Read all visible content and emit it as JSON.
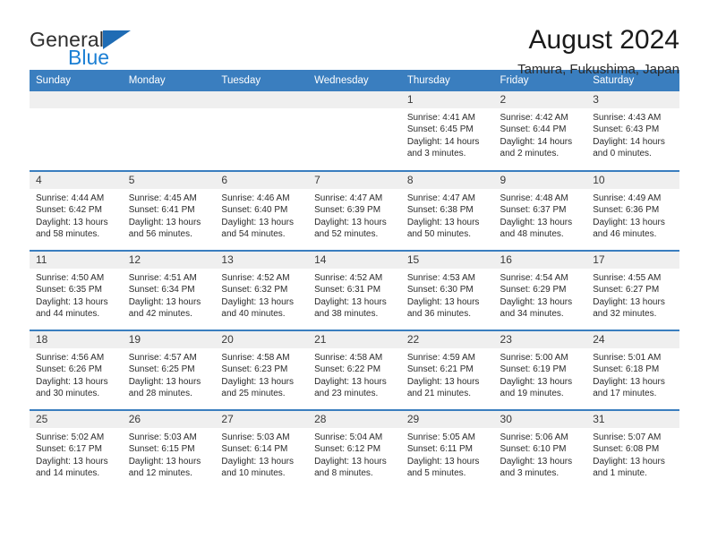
{
  "brand": {
    "name_part1": "General",
    "name_part2": "Blue",
    "logo_icon": "triangle-flag-icon",
    "accent_color": "#1f6cb4"
  },
  "header": {
    "title": "August 2024",
    "subtitle": "Tamura, Fukushima, Japan"
  },
  "calendar": {
    "header_bg": "#3a7ebf",
    "daynum_bg": "#efefef",
    "weekdays": [
      "Sunday",
      "Monday",
      "Tuesday",
      "Wednesday",
      "Thursday",
      "Friday",
      "Saturday"
    ],
    "labels": {
      "sunrise": "Sunrise:",
      "sunset": "Sunset:",
      "daylight": "Daylight:"
    },
    "weeks": [
      [
        {
          "day": ""
        },
        {
          "day": ""
        },
        {
          "day": ""
        },
        {
          "day": ""
        },
        {
          "day": "1",
          "sunrise": "Sunrise: 4:41 AM",
          "sunset": "Sunset: 6:45 PM",
          "daylight1": "Daylight: 14 hours",
          "daylight2": "and 3 minutes."
        },
        {
          "day": "2",
          "sunrise": "Sunrise: 4:42 AM",
          "sunset": "Sunset: 6:44 PM",
          "daylight1": "Daylight: 14 hours",
          "daylight2": "and 2 minutes."
        },
        {
          "day": "3",
          "sunrise": "Sunrise: 4:43 AM",
          "sunset": "Sunset: 6:43 PM",
          "daylight1": "Daylight: 14 hours",
          "daylight2": "and 0 minutes."
        }
      ],
      [
        {
          "day": "4",
          "sunrise": "Sunrise: 4:44 AM",
          "sunset": "Sunset: 6:42 PM",
          "daylight1": "Daylight: 13 hours",
          "daylight2": "and 58 minutes."
        },
        {
          "day": "5",
          "sunrise": "Sunrise: 4:45 AM",
          "sunset": "Sunset: 6:41 PM",
          "daylight1": "Daylight: 13 hours",
          "daylight2": "and 56 minutes."
        },
        {
          "day": "6",
          "sunrise": "Sunrise: 4:46 AM",
          "sunset": "Sunset: 6:40 PM",
          "daylight1": "Daylight: 13 hours",
          "daylight2": "and 54 minutes."
        },
        {
          "day": "7",
          "sunrise": "Sunrise: 4:47 AM",
          "sunset": "Sunset: 6:39 PM",
          "daylight1": "Daylight: 13 hours",
          "daylight2": "and 52 minutes."
        },
        {
          "day": "8",
          "sunrise": "Sunrise: 4:47 AM",
          "sunset": "Sunset: 6:38 PM",
          "daylight1": "Daylight: 13 hours",
          "daylight2": "and 50 minutes."
        },
        {
          "day": "9",
          "sunrise": "Sunrise: 4:48 AM",
          "sunset": "Sunset: 6:37 PM",
          "daylight1": "Daylight: 13 hours",
          "daylight2": "and 48 minutes."
        },
        {
          "day": "10",
          "sunrise": "Sunrise: 4:49 AM",
          "sunset": "Sunset: 6:36 PM",
          "daylight1": "Daylight: 13 hours",
          "daylight2": "and 46 minutes."
        }
      ],
      [
        {
          "day": "11",
          "sunrise": "Sunrise: 4:50 AM",
          "sunset": "Sunset: 6:35 PM",
          "daylight1": "Daylight: 13 hours",
          "daylight2": "and 44 minutes."
        },
        {
          "day": "12",
          "sunrise": "Sunrise: 4:51 AM",
          "sunset": "Sunset: 6:34 PM",
          "daylight1": "Daylight: 13 hours",
          "daylight2": "and 42 minutes."
        },
        {
          "day": "13",
          "sunrise": "Sunrise: 4:52 AM",
          "sunset": "Sunset: 6:32 PM",
          "daylight1": "Daylight: 13 hours",
          "daylight2": "and 40 minutes."
        },
        {
          "day": "14",
          "sunrise": "Sunrise: 4:52 AM",
          "sunset": "Sunset: 6:31 PM",
          "daylight1": "Daylight: 13 hours",
          "daylight2": "and 38 minutes."
        },
        {
          "day": "15",
          "sunrise": "Sunrise: 4:53 AM",
          "sunset": "Sunset: 6:30 PM",
          "daylight1": "Daylight: 13 hours",
          "daylight2": "and 36 minutes."
        },
        {
          "day": "16",
          "sunrise": "Sunrise: 4:54 AM",
          "sunset": "Sunset: 6:29 PM",
          "daylight1": "Daylight: 13 hours",
          "daylight2": "and 34 minutes."
        },
        {
          "day": "17",
          "sunrise": "Sunrise: 4:55 AM",
          "sunset": "Sunset: 6:27 PM",
          "daylight1": "Daylight: 13 hours",
          "daylight2": "and 32 minutes."
        }
      ],
      [
        {
          "day": "18",
          "sunrise": "Sunrise: 4:56 AM",
          "sunset": "Sunset: 6:26 PM",
          "daylight1": "Daylight: 13 hours",
          "daylight2": "and 30 minutes."
        },
        {
          "day": "19",
          "sunrise": "Sunrise: 4:57 AM",
          "sunset": "Sunset: 6:25 PM",
          "daylight1": "Daylight: 13 hours",
          "daylight2": "and 28 minutes."
        },
        {
          "day": "20",
          "sunrise": "Sunrise: 4:58 AM",
          "sunset": "Sunset: 6:23 PM",
          "daylight1": "Daylight: 13 hours",
          "daylight2": "and 25 minutes."
        },
        {
          "day": "21",
          "sunrise": "Sunrise: 4:58 AM",
          "sunset": "Sunset: 6:22 PM",
          "daylight1": "Daylight: 13 hours",
          "daylight2": "and 23 minutes."
        },
        {
          "day": "22",
          "sunrise": "Sunrise: 4:59 AM",
          "sunset": "Sunset: 6:21 PM",
          "daylight1": "Daylight: 13 hours",
          "daylight2": "and 21 minutes."
        },
        {
          "day": "23",
          "sunrise": "Sunrise: 5:00 AM",
          "sunset": "Sunset: 6:19 PM",
          "daylight1": "Daylight: 13 hours",
          "daylight2": "and 19 minutes."
        },
        {
          "day": "24",
          "sunrise": "Sunrise: 5:01 AM",
          "sunset": "Sunset: 6:18 PM",
          "daylight1": "Daylight: 13 hours",
          "daylight2": "and 17 minutes."
        }
      ],
      [
        {
          "day": "25",
          "sunrise": "Sunrise: 5:02 AM",
          "sunset": "Sunset: 6:17 PM",
          "daylight1": "Daylight: 13 hours",
          "daylight2": "and 14 minutes."
        },
        {
          "day": "26",
          "sunrise": "Sunrise: 5:03 AM",
          "sunset": "Sunset: 6:15 PM",
          "daylight1": "Daylight: 13 hours",
          "daylight2": "and 12 minutes."
        },
        {
          "day": "27",
          "sunrise": "Sunrise: 5:03 AM",
          "sunset": "Sunset: 6:14 PM",
          "daylight1": "Daylight: 13 hours",
          "daylight2": "and 10 minutes."
        },
        {
          "day": "28",
          "sunrise": "Sunrise: 5:04 AM",
          "sunset": "Sunset: 6:12 PM",
          "daylight1": "Daylight: 13 hours",
          "daylight2": "and 8 minutes."
        },
        {
          "day": "29",
          "sunrise": "Sunrise: 5:05 AM",
          "sunset": "Sunset: 6:11 PM",
          "daylight1": "Daylight: 13 hours",
          "daylight2": "and 5 minutes."
        },
        {
          "day": "30",
          "sunrise": "Sunrise: 5:06 AM",
          "sunset": "Sunset: 6:10 PM",
          "daylight1": "Daylight: 13 hours",
          "daylight2": "and 3 minutes."
        },
        {
          "day": "31",
          "sunrise": "Sunrise: 5:07 AM",
          "sunset": "Sunset: 6:08 PM",
          "daylight1": "Daylight: 13 hours",
          "daylight2": "and 1 minute."
        }
      ]
    ]
  }
}
